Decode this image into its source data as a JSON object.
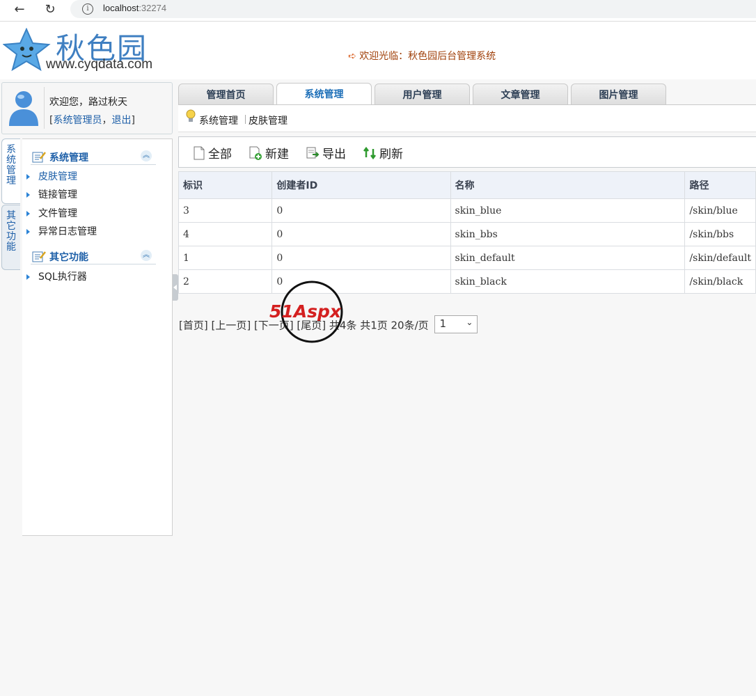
{
  "browser": {
    "url_host": "localhost",
    "url_port": ":32274"
  },
  "header": {
    "logo_name": "秋色园",
    "logo_url": "www.cyqdata.com",
    "welcome": "欢迎光临：秋色园后台管理系统"
  },
  "user": {
    "greeting_prefix": "欢迎您，",
    "name": "路过秋天",
    "bracket_open": "[",
    "role": "系统管理员",
    "comma": "，",
    "logout": "退出",
    "bracket_close": "]"
  },
  "side_tabs": [
    "系统管理",
    "其它功能"
  ],
  "sidebar": {
    "groups": [
      {
        "title": "系统管理",
        "items": [
          "皮肤管理",
          "链接管理",
          "文件管理",
          "异常日志管理"
        ]
      },
      {
        "title": "其它功能",
        "items": [
          "SQL执行器"
        ]
      }
    ]
  },
  "tabs": [
    "管理首页",
    "系统管理",
    "用户管理",
    "文章管理",
    "图片管理"
  ],
  "active_tab": "系统管理",
  "breadcrumb": [
    "系统管理",
    "皮肤管理"
  ],
  "toolbar": {
    "all": "全部",
    "new": "新建",
    "export": "导出",
    "refresh": "刷新"
  },
  "grid": {
    "columns": [
      "标识",
      "创建者ID",
      "名称",
      "路径"
    ],
    "rows": [
      [
        "3",
        "0",
        "skin_blue",
        "/skin/blue"
      ],
      [
        "4",
        "0",
        "skin_bbs",
        "/skin/bbs"
      ],
      [
        "1",
        "0",
        "skin_default",
        "/skin/default"
      ],
      [
        "2",
        "0",
        "skin_black",
        "/skin/black"
      ]
    ]
  },
  "pager": {
    "text": "[首页] [上一页] [下一页] [尾页] 共4条 共1页 20条/页",
    "page_value": "1"
  },
  "watermark": {
    "text": "51Aspx"
  },
  "colors": {
    "accent": "#1d5fa8",
    "welcome": "#a0400a",
    "header_row": "#eef2f9"
  }
}
